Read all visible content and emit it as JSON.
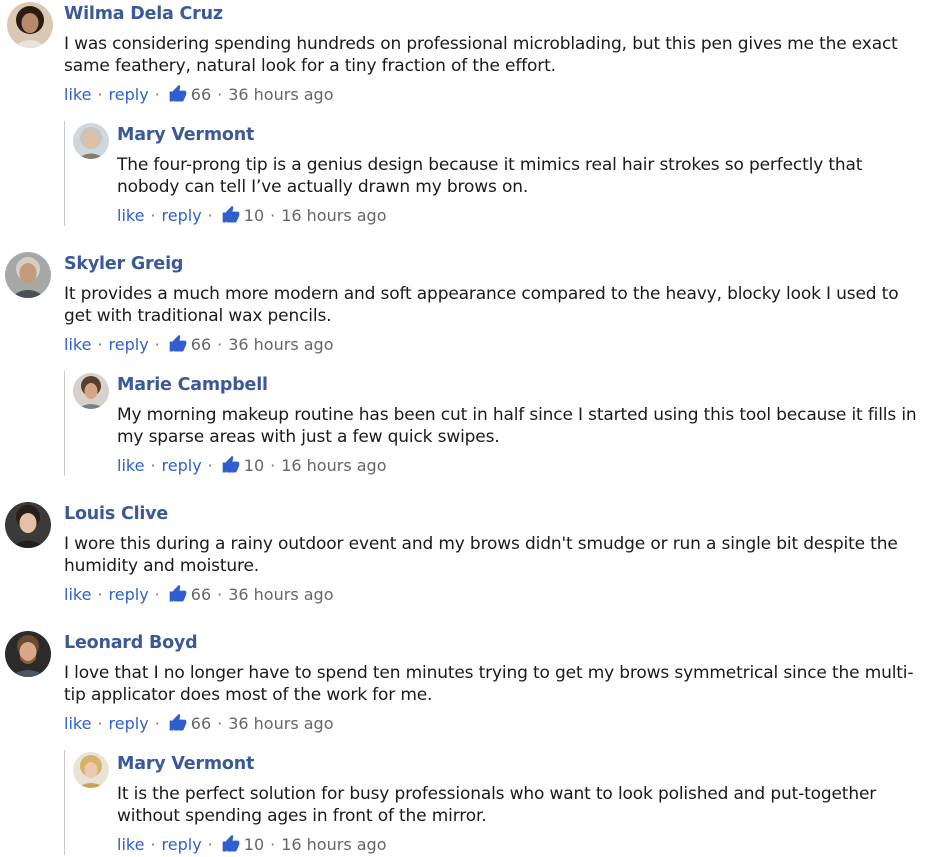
{
  "comments": [
    {
      "author": "Wilma Dela Cruz",
      "text": "I was considering spending hundreds on professional microblading, but this pen gives me the exact same feathery, natural look for a tiny fraction of the effort.",
      "like_label": "like",
      "reply_label": "reply",
      "likes": "66",
      "time": "36 hours ago",
      "avatar": "avatar-woman-curly",
      "reply": {
        "author": "Mary Vermont",
        "text": "The four-prong tip is a genius design because it mimics real hair strokes so perfectly that nobody can tell I’ve actually drawn my brows on.",
        "like_label": "like",
        "reply_label": "reply",
        "likes": "10",
        "time": "16 hours ago",
        "avatar": "avatar-older-woman"
      }
    },
    {
      "author": "Skyler Greig",
      "text": "It provides a much more modern and soft appearance compared to the heavy, blocky look I used to get with traditional wax pencils.",
      "like_label": "like",
      "reply_label": "reply",
      "likes": "66",
      "time": "36 hours ago",
      "avatar": "avatar-older-man",
      "reply": {
        "author": "Marie Campbell",
        "text": "My morning makeup routine has been cut in half since I started using this tool because it fills in my sparse areas with just a few quick swipes.",
        "like_label": "like",
        "reply_label": "reply",
        "likes": "10",
        "time": "16 hours ago",
        "avatar": "avatar-young-man"
      }
    },
    {
      "author": "Louis Clive",
      "text": "I wore this during a rainy outdoor event and my brows didn't smudge or run a single bit despite the humidity and moisture.",
      "like_label": "like",
      "reply_label": "reply",
      "likes": "66",
      "time": "36 hours ago",
      "avatar": "avatar-man-dark"
    },
    {
      "author": "Leonard Boyd",
      "text": "I love that I no longer have to spend ten minutes trying to get my brows symmetrical since the multi-tip applicator does most of the work for me.",
      "like_label": "like",
      "reply_label": "reply",
      "likes": "66",
      "time": "36 hours ago",
      "avatar": "avatar-bearded-man",
      "reply": {
        "author": "Mary Vermont",
        "text": "It is the perfect solution for busy professionals who want to look polished and put-together without spending ages in front of the mirror.",
        "like_label": "like",
        "reply_label": "reply",
        "likes": "10",
        "time": "16 hours ago",
        "avatar": "avatar-blonde-woman"
      }
    }
  ],
  "separator": "·",
  "colors": {
    "author": "#3b5998",
    "link": "#2f5fcf",
    "thumb": "#2f5fcf",
    "meta": "#666666"
  }
}
